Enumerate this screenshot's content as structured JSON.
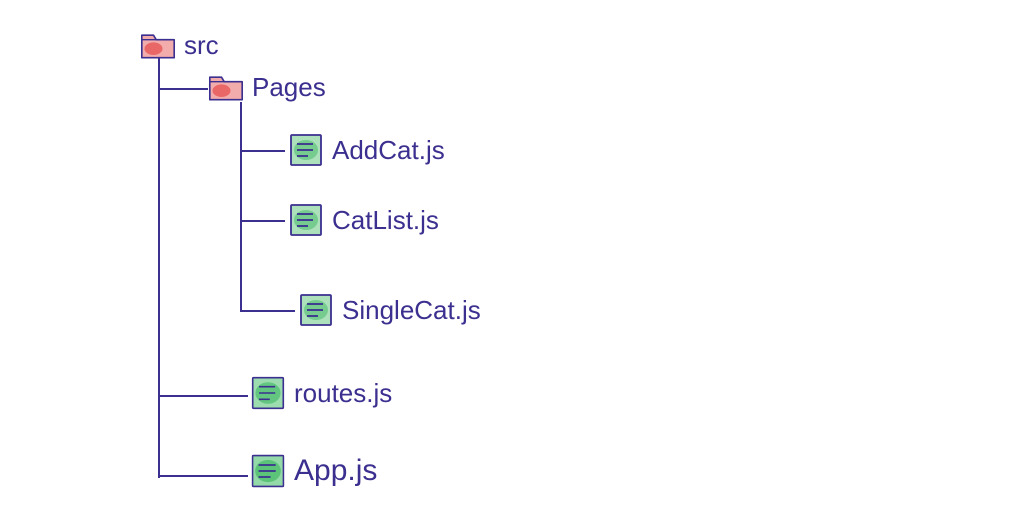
{
  "tree": {
    "root": {
      "type": "folder",
      "label": "src"
    },
    "pages_folder": {
      "type": "folder",
      "label": "Pages"
    },
    "files": {
      "addcat": {
        "type": "file",
        "label": "AddCat.js"
      },
      "catlist": {
        "type": "file",
        "label": "CatList.js"
      },
      "singlecat": {
        "type": "file",
        "label": "SingleCat.js"
      },
      "routes": {
        "type": "file",
        "label": "routes.js"
      },
      "app": {
        "type": "file",
        "label": "App.js"
      }
    }
  }
}
